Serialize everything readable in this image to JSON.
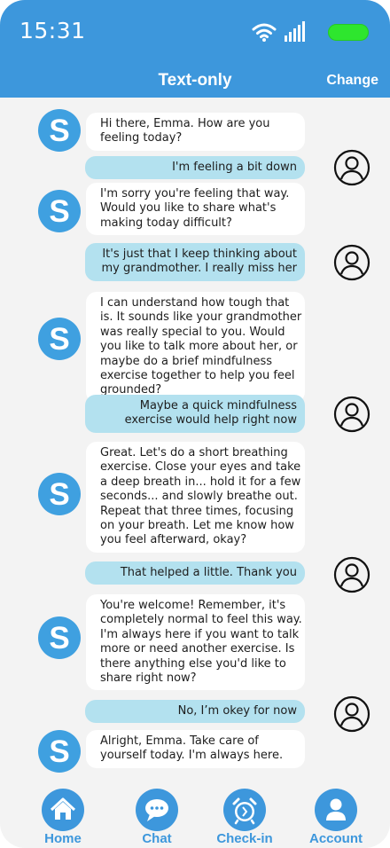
{
  "status_bar": {
    "time": "15:31"
  },
  "header": {
    "title": "Text-only",
    "change_label": "Change"
  },
  "messages": [
    {
      "sender": "bot",
      "text": "Hi there, Emma. How are you feeling today?"
    },
    {
      "sender": "user",
      "text": "I'm feeling a bit down"
    },
    {
      "sender": "bot",
      "text": "I'm sorry you're feeling that way. Would you like to share what's making today difficult?"
    },
    {
      "sender": "user",
      "text": "It's just that I keep thinking about my grandmother. I really miss her"
    },
    {
      "sender": "bot",
      "text": "I can understand how tough that is. It sounds like your grandmother was really special to you. Would you like to talk more about her, or maybe do a brief mindfulness exercise together to help you feel grounded?"
    },
    {
      "sender": "user",
      "text": "Maybe a quick mindfulness exercise would help right now"
    },
    {
      "sender": "bot",
      "text": "Great. Let's do a short breathing exercise. Close your eyes and take a deep breath in... hold it for a few seconds... and slowly breathe out. Repeat that three times, focusing on your breath. Let me know how you feel afterward, okay?"
    },
    {
      "sender": "user",
      "text": "That helped a little. Thank you"
    },
    {
      "sender": "bot",
      "text": "You're welcome! Remember, it's completely normal to feel this way. I'm always here if you want to talk more or need another exercise. Is there anything else you'd like to share right now?"
    },
    {
      "sender": "user",
      "text": "No, I’m okey for now"
    },
    {
      "sender": "bot",
      "text": "Alright, Emma. Take care of yourself today. I'm always here."
    }
  ],
  "nav": {
    "home": {
      "label": "Home",
      "icon": "house-icon"
    },
    "chat": {
      "label": "Chat",
      "icon": "chat-bubble-icon"
    },
    "checkin": {
      "label": "Check-in",
      "icon": "alarm-clock-icon"
    },
    "account": {
      "label": "Account",
      "icon": "person-icon"
    }
  },
  "colors": {
    "primary": "#3d97dc",
    "bot_bubble": "#ffffff",
    "user_bubble": "#b3e1ef",
    "battery": "#2ee62e",
    "background": "#f3f3f3"
  }
}
